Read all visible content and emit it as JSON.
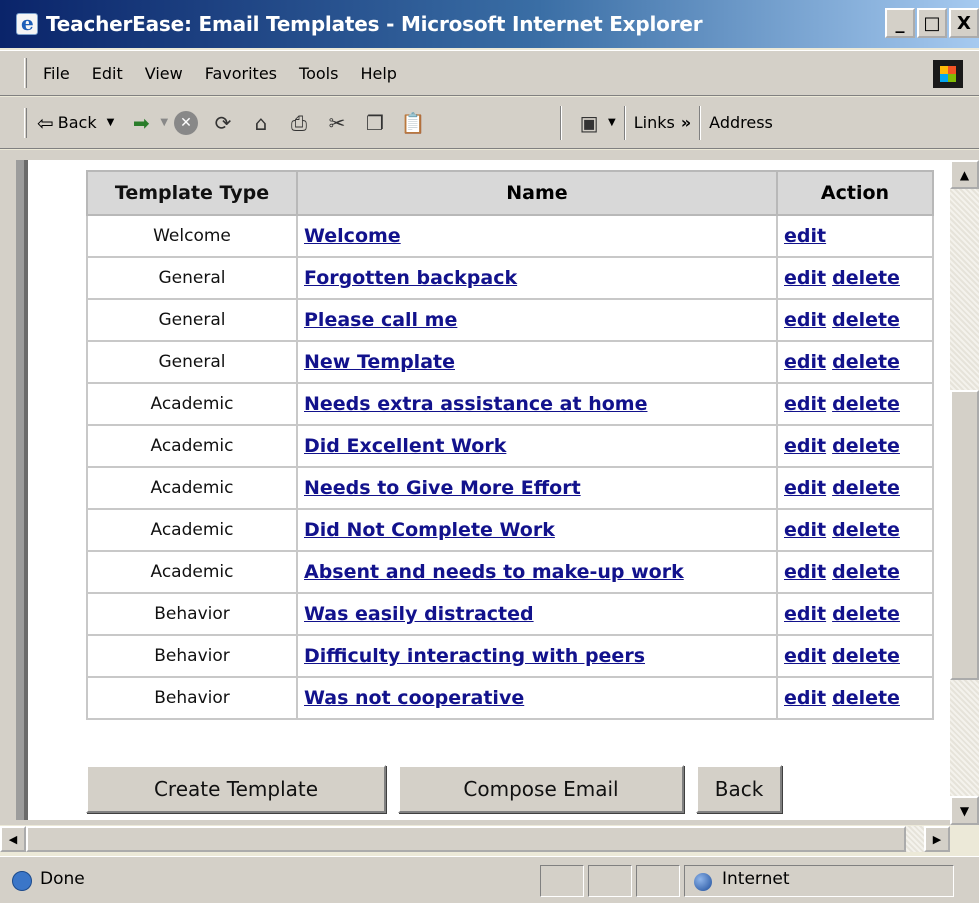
{
  "window": {
    "title": "TeacherEase: Email Templates - Microsoft Internet Explorer",
    "controls": [
      "_",
      "□",
      "X"
    ]
  },
  "menu": [
    "File",
    "Edit",
    "View",
    "Favorites",
    "Tools",
    "Help"
  ],
  "toolbar": {
    "back_label": "Back",
    "links_label": "Links",
    "chevron": "»",
    "address_label": "Address"
  },
  "table": {
    "headers": [
      "Template Type",
      "Name",
      "Action"
    ],
    "rows": [
      {
        "type": "Welcome",
        "name": "Welcome",
        "edit": "edit",
        "delete": ""
      },
      {
        "type": "General",
        "name": "Forgotten backpack",
        "edit": "edit",
        "delete": "delete"
      },
      {
        "type": "General",
        "name": "Please call me",
        "edit": "edit",
        "delete": "delete"
      },
      {
        "type": "General",
        "name": "New Template",
        "edit": "edit",
        "delete": "delete"
      },
      {
        "type": "Academic",
        "name": "Needs extra assistance at home",
        "edit": "edit",
        "delete": "delete"
      },
      {
        "type": "Academic",
        "name": "Did Excellent Work",
        "edit": "edit",
        "delete": "delete"
      },
      {
        "type": "Academic",
        "name": "Needs to Give More Effort",
        "edit": "edit",
        "delete": "delete"
      },
      {
        "type": "Academic",
        "name": "Did Not Complete Work",
        "edit": "edit",
        "delete": "delete"
      },
      {
        "type": "Academic",
        "name": "Absent and needs to make-up work",
        "edit": "edit",
        "delete": "delete"
      },
      {
        "type": "Behavior",
        "name": "Was easily distracted",
        "edit": "edit",
        "delete": "delete"
      },
      {
        "type": "Behavior",
        "name": "Difficulty interacting with peers",
        "edit": "edit",
        "delete": "delete"
      },
      {
        "type": "Behavior",
        "name": "Was not cooperative",
        "edit": "edit",
        "delete": "delete"
      }
    ]
  },
  "buttons": {
    "create": "Create Template",
    "compose": "Compose Email",
    "back": "Back"
  },
  "status": {
    "text": "Done",
    "zone": "Internet"
  },
  "colors": {
    "link": "#12128c",
    "titlebar_start": "#0a246a",
    "chrome": "#d4d0c8"
  }
}
